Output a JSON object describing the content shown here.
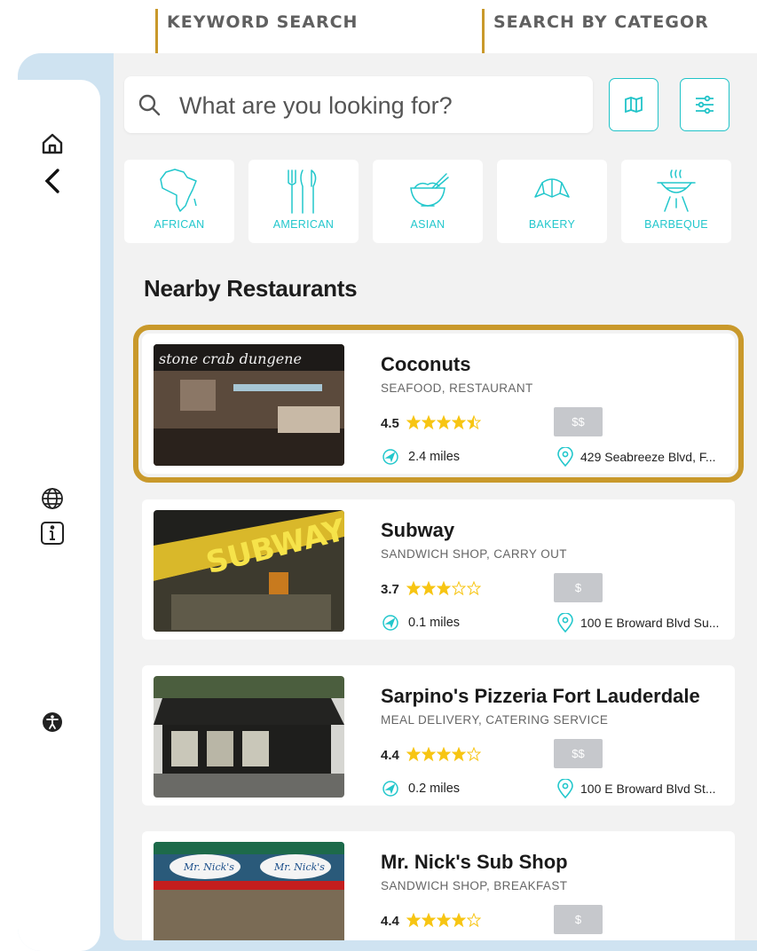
{
  "callouts": {
    "keyword": "KEYWORD SEARCH",
    "category": "SEARCH BY CATEGOR"
  },
  "sidebar": {
    "icons": [
      "home-icon",
      "back-chevron-icon",
      "globe-icon",
      "info-icon",
      "accessibility-icon"
    ]
  },
  "search": {
    "placeholder": "What are you looking for?",
    "value": ""
  },
  "toolbar": {
    "buttons": [
      "map-icon",
      "filter-sliders-icon"
    ]
  },
  "categories": [
    {
      "label": "AFRICAN",
      "icon": "africa-icon"
    },
    {
      "label": "AMERICAN",
      "icon": "cutlery-icon"
    },
    {
      "label": "ASIAN",
      "icon": "bowl-chopsticks-icon"
    },
    {
      "label": "BAKERY",
      "icon": "croissant-icon"
    },
    {
      "label": "BARBEQUE",
      "icon": "grill-icon"
    }
  ],
  "section": {
    "title": "Nearby Restaurants"
  },
  "restaurants": [
    {
      "name": "Coconuts",
      "category": "SEAFOOD, RESTAURANT",
      "rating": "4.5",
      "stars": 4.5,
      "price": "$$",
      "distance": "2.4 miles",
      "address": "429 Seabreeze Blvd, F...",
      "photo_sign": "stone crab dungene"
    },
    {
      "name": "Subway",
      "category": "SANDWICH SHOP, CARRY OUT",
      "rating": "3.7",
      "stars": 3,
      "price": "$",
      "distance": "0.1 miles",
      "address": "100 E Broward Blvd Su...",
      "photo_sign": "SUBWAY"
    },
    {
      "name": "Sarpino's Pizzeria Fort Lauderdale",
      "category": "MEAL DELIVERY, CATERING SERVICE",
      "rating": "4.4",
      "stars": 4,
      "price": "$$",
      "distance": "0.2 miles",
      "address": "100 E Broward Blvd St...",
      "photo_sign": ""
    },
    {
      "name": "Mr. Nick's Sub Shop",
      "category": "SANDWICH SHOP, BREAKFAST",
      "rating": "4.4",
      "stars": 4,
      "price": "$",
      "distance": "",
      "address": "",
      "photo_sign": "Mr. Nick's"
    }
  ],
  "colors": {
    "accent": "#22c7cc",
    "highlight": "#c9992b",
    "star": "#f7c513",
    "sidebar_bg": "#cfe3f1",
    "content_bg": "#f2f2f2"
  }
}
